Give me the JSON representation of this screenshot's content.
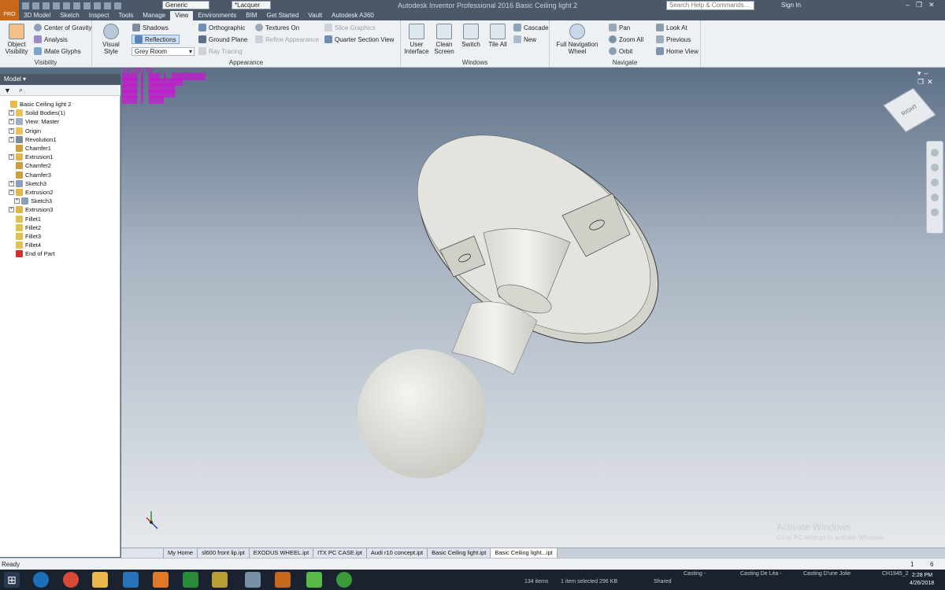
{
  "app": {
    "title": "Autodesk Inventor Professional 2016   Basic Ceiling light 2",
    "pro_badge": "PRO",
    "appearance_combo": "Generic",
    "material_combo": "*Lacquer",
    "search_placeholder": "Search Help & Commands...",
    "sign_in": "Sign In"
  },
  "tabs": [
    "3D Model",
    "Sketch",
    "Inspect",
    "Tools",
    "Manage",
    "View",
    "Environments",
    "BIM",
    "Get Started",
    "Vault",
    "Autodesk A360"
  ],
  "active_tab": "View",
  "ribbon": {
    "visibility": {
      "title": "Visibility",
      "object_visibility": "Object Visibility",
      "center_of_gravity": "Center of Gravity",
      "analysis": "Analysis",
      "imate_glyphs": "iMate Glyphs"
    },
    "appearance": {
      "title": "Appearance",
      "visual_style": "Visual Style",
      "shadows": "Shadows",
      "reflections": "Reflections",
      "grey_room": "Grey Room",
      "orthographic": "Orthographic",
      "ground_plane": "Ground Plane",
      "ray_tracing": "Ray Tracing",
      "textures_on": "Textures On",
      "refine_appearance": "Refine Appearance",
      "slice_graphics": "Slice Graphics",
      "quarter_section_view": "Quarter Section View"
    },
    "windows": {
      "title": "Windows",
      "user_interface": "User Interface",
      "clean_screen": "Clean Screen",
      "switch": "Switch",
      "tile_all": "Tile All",
      "cascade": "Cascade",
      "new": "New"
    },
    "navigate": {
      "title": "Navigate",
      "full_navigation_wheel": "Full Navigation Wheel",
      "pan": "Pan",
      "zoom_all": "Zoom All",
      "orbit": "Orbit",
      "look_at": "Look At",
      "previous": "Previous",
      "home_view": "Home View"
    }
  },
  "browser": {
    "header": "Model",
    "items": [
      {
        "label": "Basic Ceiling light 2",
        "depth": 0,
        "expandable": false,
        "color": "#e8b84a"
      },
      {
        "label": "Solid Bodies(1)",
        "depth": 1,
        "expandable": true,
        "color": "#e8c35a"
      },
      {
        "label": "View: Master",
        "depth": 1,
        "expandable": true,
        "color": "#9cb0c4"
      },
      {
        "label": "Origin",
        "depth": 1,
        "expandable": true,
        "color": "#e8c35a"
      },
      {
        "label": "Revolution1",
        "depth": 1,
        "expandable": true,
        "color": "#7c8c9c"
      },
      {
        "label": "Chamfer1",
        "depth": 1,
        "expandable": false,
        "color": "#c8a040"
      },
      {
        "label": "Extrusion1",
        "depth": 1,
        "expandable": true,
        "color": "#e0b84a"
      },
      {
        "label": "Chamfer2",
        "depth": 1,
        "expandable": false,
        "color": "#c8a040"
      },
      {
        "label": "Chamfer3",
        "depth": 1,
        "expandable": false,
        "color": "#c8a040"
      },
      {
        "label": "Sketch3",
        "depth": 1,
        "expandable": true,
        "color": "#8aa0b8"
      },
      {
        "label": "Extrusion2",
        "depth": 1,
        "expandable": true,
        "color": "#e0b84a"
      },
      {
        "label": "Sketch3",
        "depth": 2,
        "expandable": true,
        "color": "#8aa0b8"
      },
      {
        "label": "Extrusion3",
        "depth": 1,
        "expandable": true,
        "color": "#e0b84a"
      },
      {
        "label": "Fillet1",
        "depth": 1,
        "expandable": false,
        "color": "#e0c050"
      },
      {
        "label": "Fillet2",
        "depth": 1,
        "expandable": false,
        "color": "#e0c050"
      },
      {
        "label": "Fillet3",
        "depth": 1,
        "expandable": false,
        "color": "#e0c050"
      },
      {
        "label": "Fillet4",
        "depth": 1,
        "expandable": false,
        "color": "#e0c050"
      },
      {
        "label": "End of Part",
        "depth": 1,
        "expandable": false,
        "color": "#d23030"
      }
    ]
  },
  "viewport": {
    "hud_time": "14:28:35",
    "viewcube_label": "RIGHT",
    "watermark_line1": "Activate Windows",
    "watermark_line2": "Go to PC settings to activate Windows."
  },
  "document_tabs": [
    "My Home",
    "sl600 front lip.ipt",
    "EXODUS WHEEL.ipt",
    "ITX PC CASE.ipt",
    "Audi r10 concept.ipt",
    "Basic Ceiling light.ipt",
    "Basic Ceiling light...ipt"
  ],
  "active_document_tab": "Basic Ceiling light...ipt",
  "status": {
    "text": "Ready",
    "count1": "1",
    "count2": "6"
  },
  "taskbar": {
    "explorer_items": "134 items",
    "explorer_selected": "1 item selected  296 KB",
    "explorer_shared": "Shared",
    "casting1": "Casting -",
    "casting2": "Casting De Léa -",
    "casting3": "Casting D'une Jolie",
    "ch_label": "CH1945_2",
    "time": "2:28 PM",
    "date": "4/26/2018"
  },
  "colors": {
    "titlebar": "#4a5868",
    "ribbon": "#eef1f4",
    "hud": "#e000e0",
    "pro_badge": "#c8661a"
  }
}
